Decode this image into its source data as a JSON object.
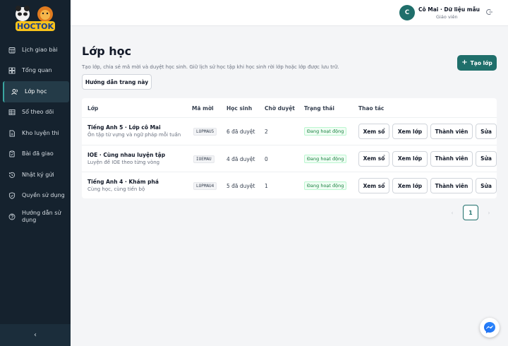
{
  "brand": {
    "logo_text": "HOCTOK"
  },
  "sidebar": {
    "items": [
      {
        "label": "Lịch giao bài",
        "icon": "calendar-icon",
        "active": false
      },
      {
        "label": "Tổng quan",
        "icon": "dashboard-icon",
        "active": false
      },
      {
        "label": "Lớp học",
        "icon": "users-icon",
        "active": true
      },
      {
        "label": "Sổ theo dõi",
        "icon": "table-icon",
        "active": false
      },
      {
        "label": "Kho luyện thi",
        "icon": "document-icon",
        "active": false
      },
      {
        "label": "Bài đã giao",
        "icon": "clipboard-icon",
        "active": false
      },
      {
        "label": "Nhật ký gửi",
        "icon": "history-icon",
        "active": false
      },
      {
        "label": "Quyền sử dụng",
        "icon": "shield-icon",
        "active": false
      },
      {
        "label": "Hướng dẫn sử dụng",
        "icon": "help-icon",
        "active": false
      }
    ],
    "collapse_label": "‹"
  },
  "user": {
    "initial": "C",
    "name": "Cô Mai · Dữ liệu mẫu",
    "role": "Giáo viên"
  },
  "page": {
    "title": "Lớp học",
    "description": "Tạo lớp, chia sẻ mã mời và duyệt học sinh. Giữ lịch sử học tập khi học sinh rời lớp hoặc lớp được lưu trữ.",
    "guide_button": "Hướng dẫn trang này",
    "create_button": "Tạo lớp"
  },
  "table": {
    "headers": [
      "Lớp",
      "Mã mời",
      "Học sinh",
      "Chờ duyệt",
      "Trạng thái",
      "Thao tác"
    ],
    "rows": [
      {
        "name": "Tiếng Anh 5 · Lớp cô Mai",
        "subtitle": "Ôn tập từ vựng và ngữ pháp mỗi tuần",
        "code": "LOPMAU5",
        "students": "6 đã duyệt",
        "pending": "2",
        "status": "Đang hoạt động"
      },
      {
        "name": "IOE · Cùng nhau luyện tập",
        "subtitle": "Luyện đề IOE theo từng vòng",
        "code": "IOEMAU",
        "students": "4 đã duyệt",
        "pending": "0",
        "status": "Đang hoạt động"
      },
      {
        "name": "Tiếng Anh 4 · Khám phá",
        "subtitle": "Cùng học, cùng tiến bộ",
        "code": "LOPMAU4",
        "students": "5 đã duyệt",
        "pending": "1",
        "status": "Đang hoạt động"
      }
    ],
    "actions": {
      "view_book": "Xem sổ",
      "view_class": "Xem lớp",
      "members": "Thành viên",
      "edit": "Sửa"
    }
  },
  "pagination": {
    "prev": "‹",
    "current": "1",
    "next": "›"
  },
  "colors": {
    "accent": "#1f6f6b",
    "sidebar_bg": "#15222e",
    "status_green": "#15803d"
  }
}
